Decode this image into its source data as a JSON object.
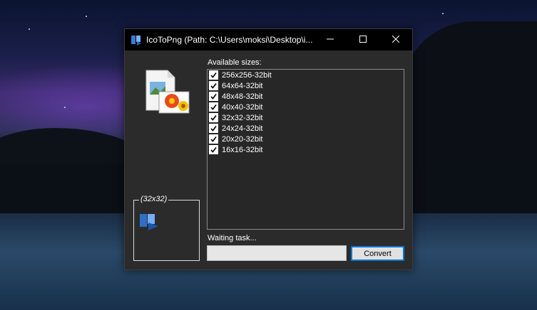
{
  "window": {
    "title": "IcoToPng (Path: C:\\Users\\moksi\\Desktop\\i..."
  },
  "titlebar": {
    "minimize_icon": "minimize-icon",
    "maximize_icon": "maximize-icon",
    "close_icon": "close-icon"
  },
  "preview": {
    "legend": "(32x32)"
  },
  "sizes": {
    "label": "Available sizes:",
    "items": [
      {
        "label": "256x256-32bit",
        "checked": true
      },
      {
        "label": "64x64-32bit",
        "checked": true
      },
      {
        "label": "48x48-32bit",
        "checked": true
      },
      {
        "label": "40x40-32bit",
        "checked": true
      },
      {
        "label": "32x32-32bit",
        "checked": true
      },
      {
        "label": "24x24-32bit",
        "checked": true
      },
      {
        "label": "20x20-32bit",
        "checked": true
      },
      {
        "label": "16x16-32bit",
        "checked": true
      }
    ]
  },
  "status": {
    "text": "Waiting task...",
    "progress": 0
  },
  "actions": {
    "convert_label": "Convert"
  },
  "colors": {
    "accent": "#0078d7",
    "window_bg": "#2b2b2b",
    "titlebar_bg": "#000000"
  }
}
